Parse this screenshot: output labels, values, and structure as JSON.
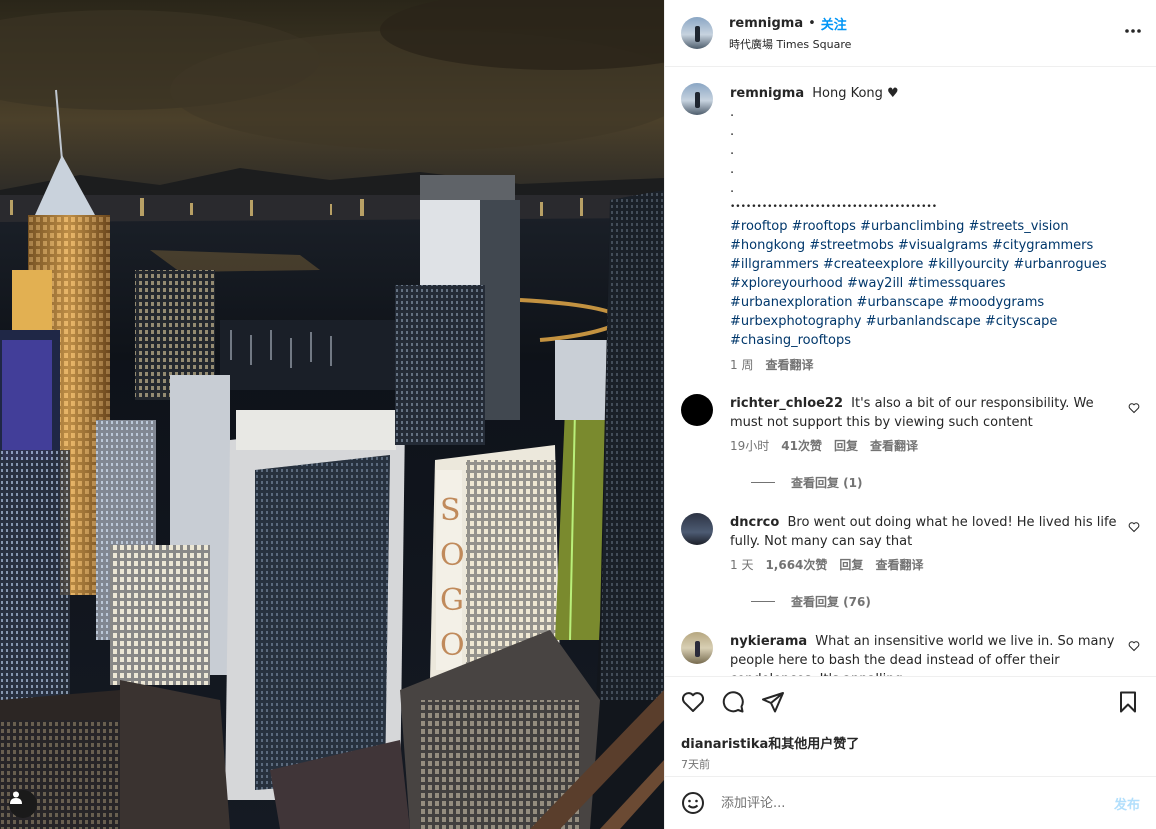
{
  "post": {
    "username": "remnigma",
    "separator": "•",
    "follow_label": "关注",
    "location": "時代廣場 Times Square",
    "more_icon": "more-horizontal-icon"
  },
  "caption": {
    "username": "remnigma",
    "text": "Hong Kong ♥",
    "dots": [
      ".",
      ".",
      ".",
      ".",
      "."
    ],
    "divider": "•••••••••••••••••••••••••••••••••••••••",
    "hashtags": "#rooftop #rooftops #urbanclimbing #streets_vision #hongkong #streetmobs #visualgrams #citygrammers #illgrammers #createexplore #killyourcity #urbanrogues #xploreyourhood #way2ill #timessquares #urbanexploration #urbanscape #moodygrams #urbexphotography #urbanlandscape #cityscape #chasing_rooftops",
    "time": "1 周",
    "translate": "查看翻译"
  },
  "comments": [
    {
      "username": "richter_chloe22",
      "text": "It's also a bit of our responsibility. We must not support this by viewing such content",
      "time": "19小时",
      "likes": "41次赞",
      "reply": "回复",
      "translate": "查看翻译",
      "view_replies": "查看回复 (1)"
    },
    {
      "username": "dncrco",
      "text": "Bro went out doing what he loved! He lived his life fully. Not many can say that",
      "time": "1 天",
      "likes": "1,664次赞",
      "reply": "回复",
      "translate": "查看翻译",
      "view_replies": "查看回复 (76)"
    },
    {
      "username": "nykierama",
      "text": "What an insensitive world we live in. So many people here to bash the dead instead of offer their condolences. It's appalling."
    }
  ],
  "actions": {
    "icons": [
      "heart-icon",
      "comment-icon",
      "share-icon",
      "bookmark-icon"
    ],
    "liked_by": "dianaristika和其他用户赞了",
    "posted": "7天前"
  },
  "add_comment": {
    "placeholder": "添加评论...",
    "post_label": "发布"
  },
  "colors": {
    "accent": "#0095f6",
    "hashtag": "#00376b",
    "muted": "#737373",
    "post_disabled": "#b2dffc"
  }
}
